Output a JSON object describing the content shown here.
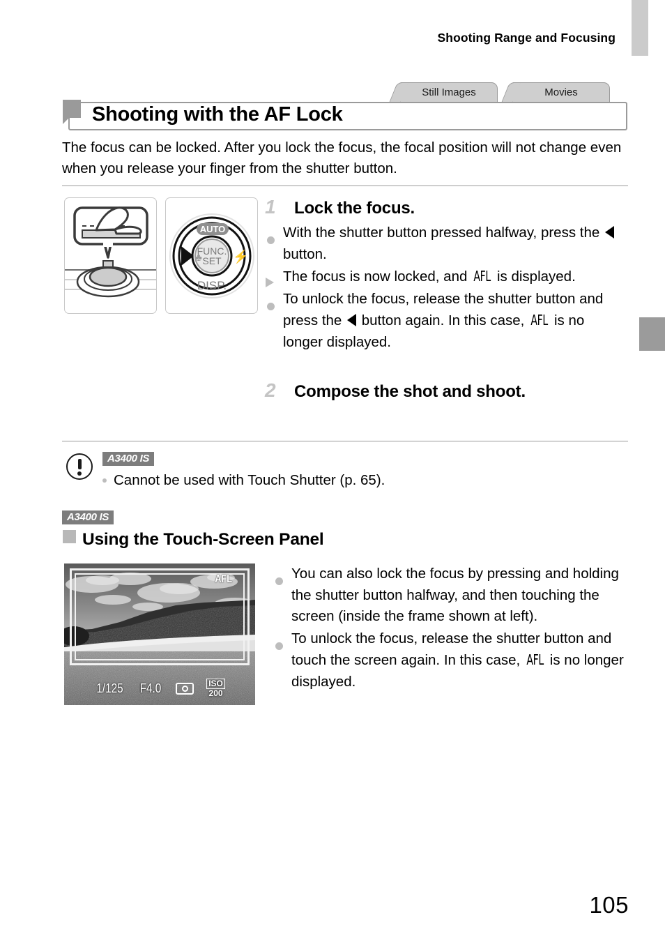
{
  "header": {
    "running_title": "Shooting Range and Focusing"
  },
  "side_tabs": [
    {
      "name": "index-tab-upper",
      "color": "#cbcbcb"
    },
    {
      "name": "index-tab-current",
      "color": "#9b9b9b"
    }
  ],
  "mode_tabs": [
    {
      "label": "Still Images"
    },
    {
      "label": "Movies"
    }
  ],
  "section": {
    "title": "Shooting with the AF Lock",
    "intro": "The focus can be locked. After you lock the focus, the focal position will not change even when you release your finger from the shutter button."
  },
  "figures": {
    "shutter_button_label": "shutter-button-press-illustration",
    "control_dial": {
      "auto_label": "AUTO",
      "func_label": "FUNC.",
      "set_label": "SET",
      "disp_label": "DISP."
    }
  },
  "steps": [
    {
      "number": "1",
      "title": "Lock the focus.",
      "bullets": [
        {
          "marker": "dot",
          "parts": [
            {
              "type": "text",
              "value": "With the shutter button pressed halfway, press the "
            },
            {
              "type": "arrow-left"
            },
            {
              "type": "text",
              "value": " button."
            }
          ]
        },
        {
          "marker": "triangle",
          "parts": [
            {
              "type": "text",
              "value": "The focus is now locked, and "
            },
            {
              "type": "afl",
              "value": "AFL"
            },
            {
              "type": "text",
              "value": " is displayed."
            }
          ]
        },
        {
          "marker": "dot",
          "parts": [
            {
              "type": "text",
              "value": "To unlock the focus, release the shutter button and press the "
            },
            {
              "type": "arrow-left"
            },
            {
              "type": "text",
              "value": " button again. In this case, "
            },
            {
              "type": "afl",
              "value": "AFL"
            },
            {
              "type": "text",
              "value": " is no longer displayed."
            }
          ]
        }
      ]
    },
    {
      "number": "2",
      "title": "Compose the shot and shoot.",
      "bullets": []
    }
  ],
  "caution": {
    "model_badge": "A3400 IS",
    "text": "Cannot be used with Touch Shutter (p. 65)."
  },
  "subsection": {
    "model_badge": "A3400 IS",
    "title": "Using the Touch-Screen Panel",
    "bullets": [
      {
        "marker": "dot",
        "parts": [
          {
            "type": "text",
            "value": "You can also lock the focus by pressing and holding the shutter button halfway, and then touching the screen (inside the frame shown at left)."
          }
        ]
      },
      {
        "marker": "dot",
        "parts": [
          {
            "type": "text",
            "value": "To unlock the focus, release the shutter button and touch the screen again. In this case, "
          },
          {
            "type": "afl",
            "value": "AFL"
          },
          {
            "type": "text",
            "value": " is no longer displayed."
          }
        ]
      }
    ]
  },
  "lcd_screen": {
    "afl_indicator": "AFL",
    "shutter_speed": "1/125",
    "aperture": "F4.0",
    "metering_icon": "metering-mode-icon",
    "iso_label": "ISO",
    "iso_value": "200"
  },
  "footer": {
    "page_number": "105"
  }
}
